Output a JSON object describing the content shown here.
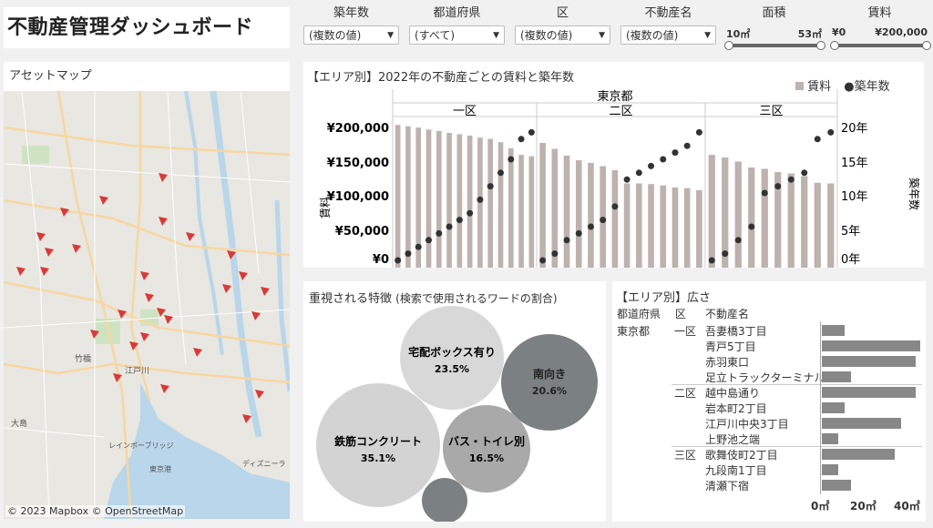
{
  "title": "不動産管理ダッシュボード",
  "filters": {
    "age": {
      "label": "築年数",
      "value": "(複数の値)"
    },
    "pref": {
      "label": "都道府県",
      "value": "(すべて)"
    },
    "ward": {
      "label": "区",
      "value": "(複数の値)"
    },
    "name": {
      "label": "不動産名",
      "value": "(複数の値)"
    },
    "area": {
      "label": "面積",
      "min": "10㎡",
      "max": "53㎡",
      "fill_fraction": 1.0
    },
    "rent": {
      "label": "賃料",
      "min": "¥0",
      "max": "¥200,000",
      "fill_fraction": 1.0
    }
  },
  "map": {
    "title": "アセットマップ",
    "copyright": "© 2023 Mapbox © OpenStreetMap",
    "labels": [
      "竹橋",
      "江戸川",
      "大島",
      "東京港",
      "ディズニーラ",
      "レインボーブリッジ"
    ]
  },
  "rent_chart": {
    "title_prefix": "【エリア別】",
    "title_main": "2022年の不動産ごとの賃料と築年数",
    "legend_bar": "賃料",
    "legend_dot": "築年数",
    "region": "東京都",
    "ylabel_left": "賃料",
    "ylabel_right": "築年数",
    "y_ticks": [
      "¥200,000",
      "¥150,000",
      "¥100,000",
      "¥50,000",
      "¥0"
    ],
    "y2_ticks": [
      "20年",
      "15年",
      "10年",
      "5年",
      "0年"
    ]
  },
  "chart_data": {
    "type": "bar",
    "ylim": [
      0,
      200000
    ],
    "y2lim": [
      0,
      20
    ],
    "groups": [
      {
        "name": "一区",
        "rent": [
          201000,
          199000,
          197000,
          194000,
          192000,
          189000,
          187000,
          185000,
          182000,
          180000,
          175000,
          166000,
          156000,
          154000
        ],
        "age": [
          0,
          1,
          2,
          3,
          4,
          5,
          6,
          7,
          9,
          11,
          13,
          15,
          18,
          19
        ]
      },
      {
        "name": "二区",
        "rent": [
          174000,
          165000,
          155000,
          148000,
          144000,
          139000,
          133000,
          113000,
          113000,
          112000,
          110000,
          107000,
          106000,
          103000
        ],
        "age": [
          0,
          1,
          3,
          4,
          5,
          6,
          8,
          12,
          13,
          14,
          15,
          16,
          17,
          19
        ]
      },
      {
        "name": "三区",
        "rent": [
          156000,
          152000,
          146000,
          137000,
          135000,
          130000,
          128000,
          124000,
          114000,
          113000
        ],
        "age": [
          0,
          1,
          3,
          5,
          10,
          11,
          12,
          13,
          18,
          19
        ]
      }
    ]
  },
  "bubble": {
    "title": "重視される特徴",
    "subtitle": "(検索で使用されるワードの割合)",
    "items": [
      {
        "label": "鉄筋コンクリート",
        "value": "35.1%"
      },
      {
        "label": "宅配ボックス有り",
        "value": "23.5%"
      },
      {
        "label": "南向き",
        "value": "20.6%"
      },
      {
        "label": "バス・トイレ別",
        "value": "16.5%"
      },
      {
        "label": "",
        "value": ""
      }
    ]
  },
  "size_chart": {
    "title_prefix": "【エリア別】",
    "title_main": "広さ",
    "headers": [
      "都道府県",
      "区",
      "不動産名"
    ],
    "pref": "東京都",
    "rows": [
      {
        "ward": "一区",
        "name": "吾妻橋3丁目",
        "area": 11
      },
      {
        "ward": "",
        "name": "青戸5丁目",
        "area": 47
      },
      {
        "ward": "",
        "name": "赤羽東口",
        "area": 45
      },
      {
        "ward": "",
        "name": "足立トラックターミナル",
        "area": 14
      },
      {
        "ward": "二区",
        "name": "越中島通り",
        "area": 45
      },
      {
        "ward": "",
        "name": "岩本町2丁目",
        "area": 11
      },
      {
        "ward": "",
        "name": "江戸川中央3丁目",
        "area": 38
      },
      {
        "ward": "",
        "name": "上野池之端",
        "area": 8
      },
      {
        "ward": "三区",
        "name": "歌舞伎町2丁目",
        "area": 35
      },
      {
        "ward": "",
        "name": "九段南1丁目",
        "area": 8
      },
      {
        "ward": "",
        "name": "清瀬下宿",
        "area": 14
      }
    ],
    "x_ticks": [
      "0㎡",
      "20㎡",
      "40㎡"
    ],
    "xlim": [
      0,
      48
    ]
  }
}
